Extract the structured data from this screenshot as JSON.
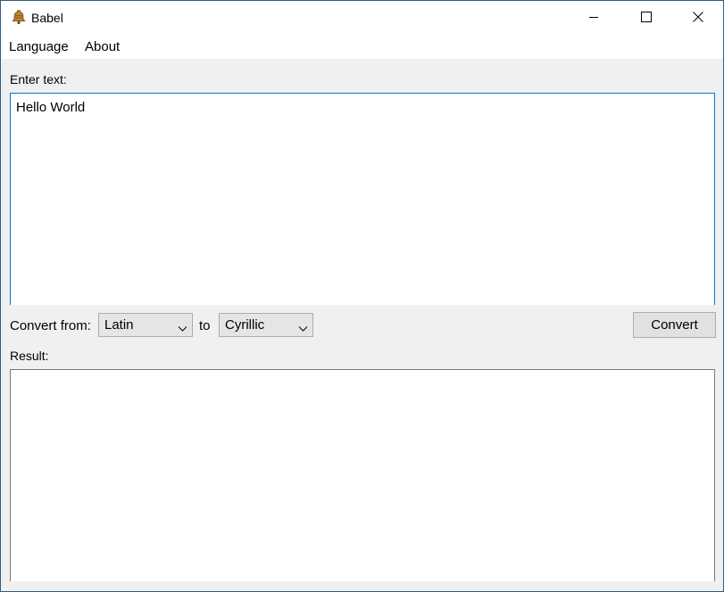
{
  "window": {
    "title": "Babel",
    "app_icon": "bell-icon",
    "controls": {
      "minimize_icon": "minimize-icon",
      "maximize_icon": "maximize-icon",
      "close_icon": "close-icon"
    }
  },
  "menu": {
    "items": [
      "Language",
      "About"
    ]
  },
  "input_section": {
    "label": "Enter text:",
    "value": "Hello World"
  },
  "conversion": {
    "from_label": "Convert from:",
    "from_value": "Latin",
    "to_label": "to",
    "to_value": "Cyrillic",
    "convert_label": "Convert"
  },
  "result_section": {
    "label": "Result:",
    "value": ""
  },
  "colors": {
    "focus_border": "#0078d7",
    "window_border": "#2b5f86",
    "surface": "#f0f0f0"
  }
}
